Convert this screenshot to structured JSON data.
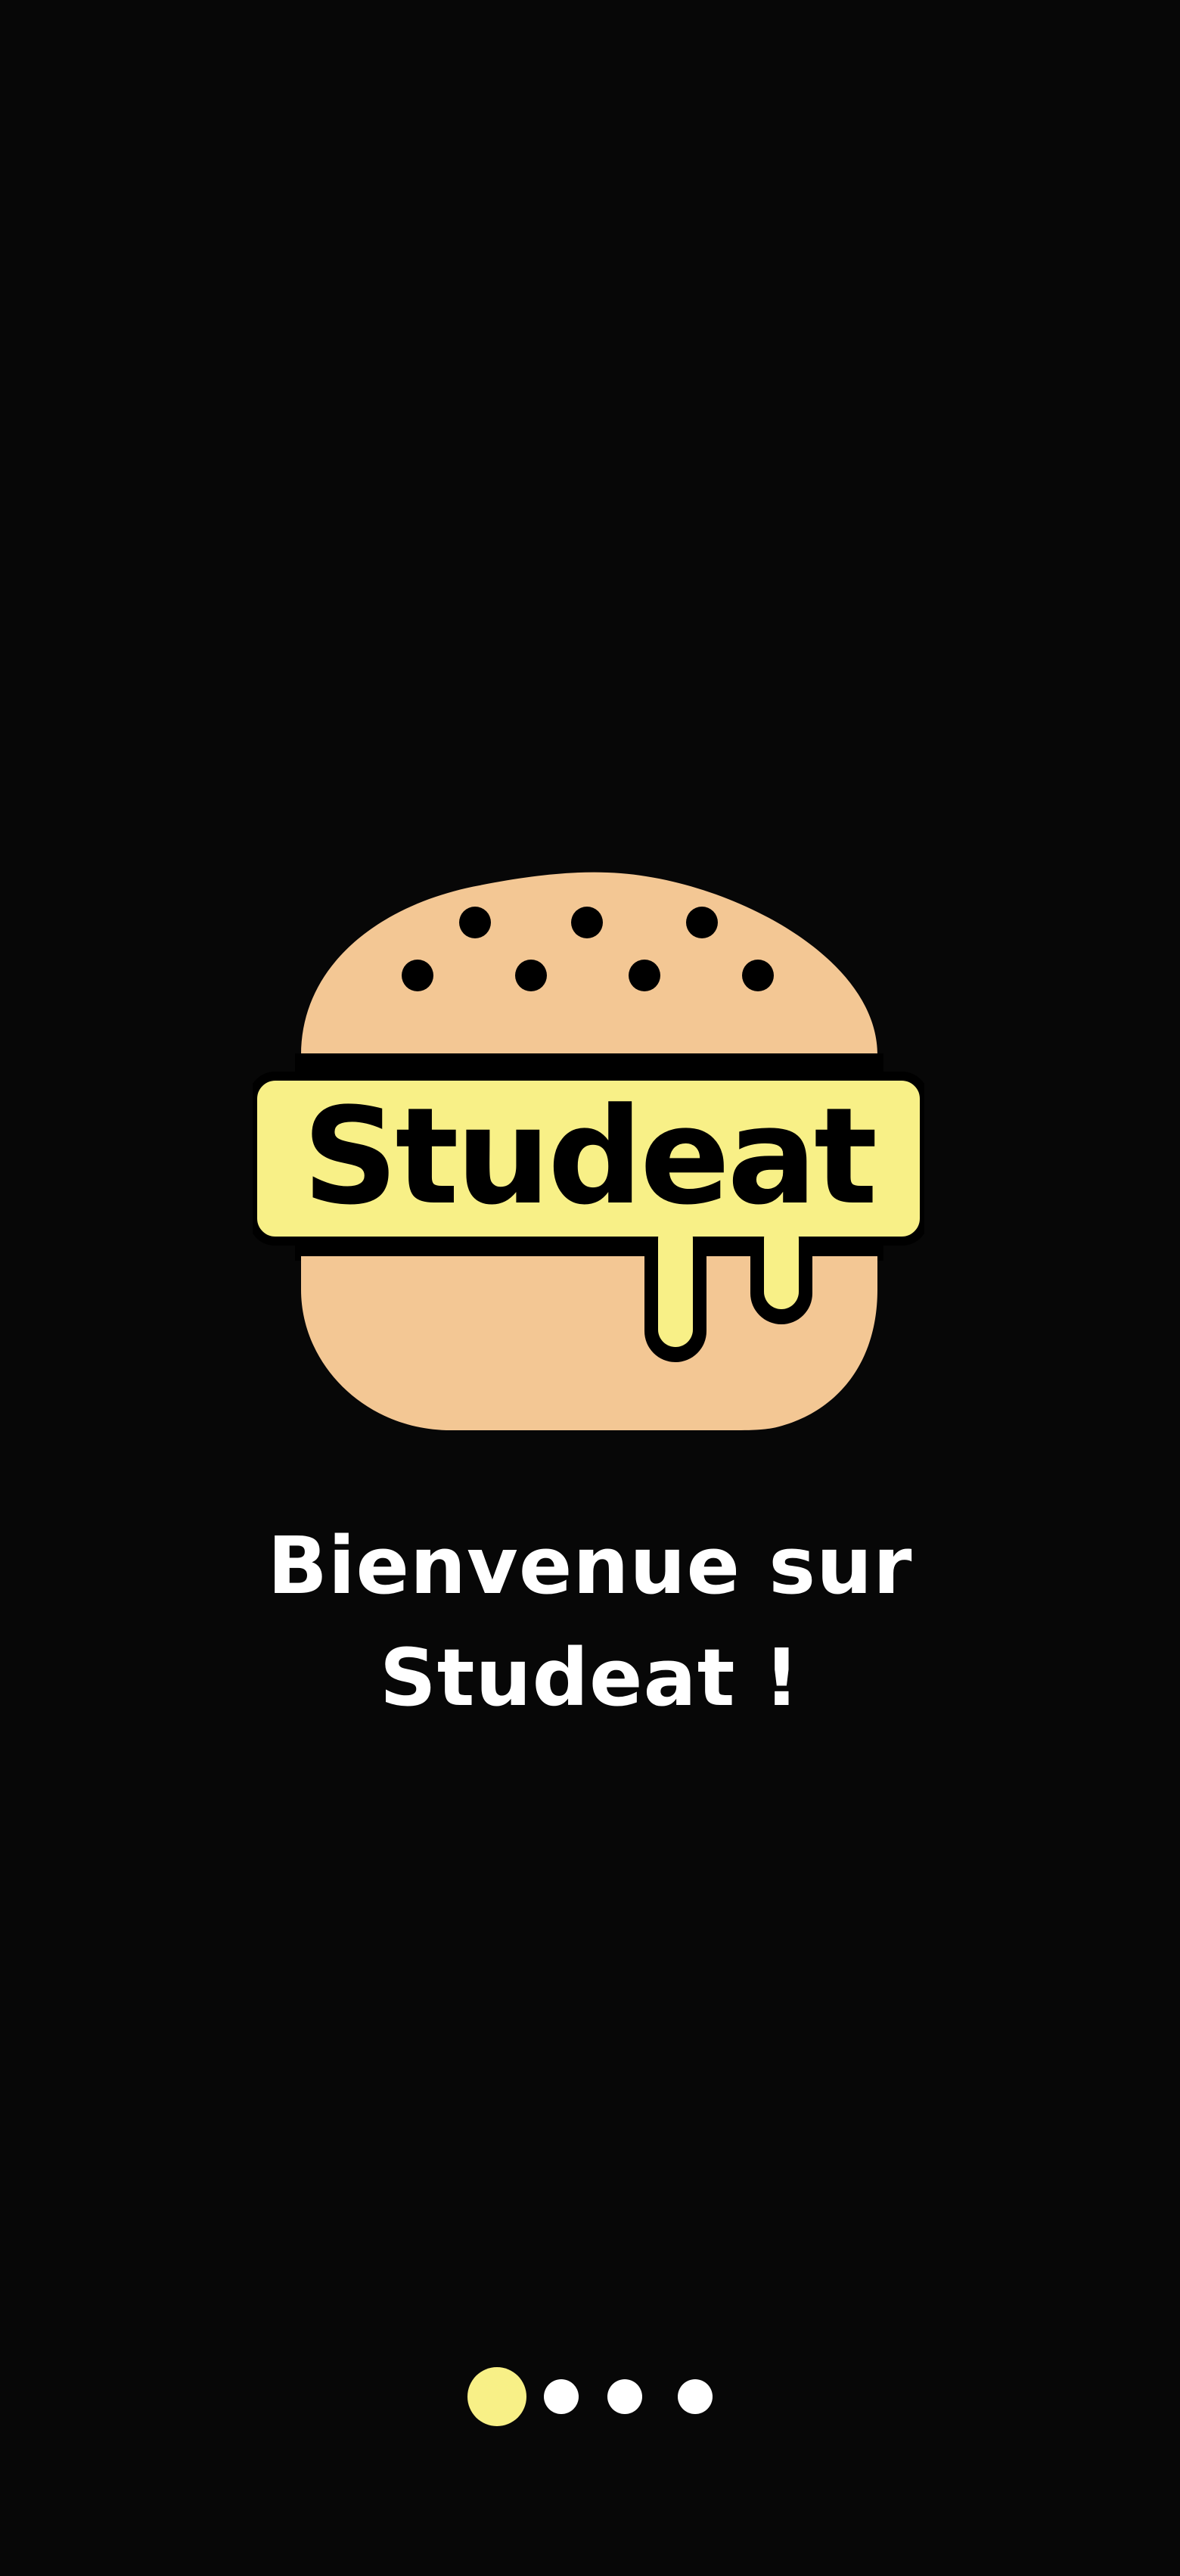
{
  "app": {
    "logo_text": "Studeat",
    "logo_icon": "burger-logo-icon"
  },
  "welcome": {
    "line1": "Bienvenue sur",
    "line2": "Studeat !"
  },
  "pager": {
    "pages": 4,
    "current": 1
  },
  "colors": {
    "background": "#070707",
    "bun": "#F3C794",
    "cheese": "#F8F087",
    "outline": "#000000",
    "text": "#FFFFFF",
    "dot_active": "#F8F087",
    "dot_inactive": "#FFFFFF"
  }
}
